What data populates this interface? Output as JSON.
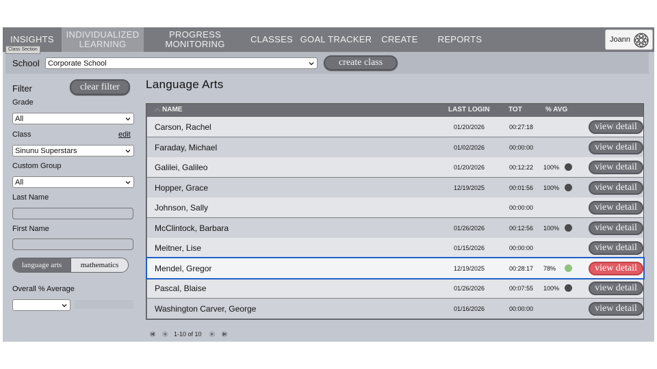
{
  "nav": {
    "items": [
      {
        "label": "INSIGHTS"
      },
      {
        "label": "INDIVIDUALIZED LEARNING"
      },
      {
        "label": "PROGRESS MONITORING"
      },
      {
        "label": "CLASSES"
      },
      {
        "label": "GOAL TRACKER"
      },
      {
        "label": "CREATE"
      },
      {
        "label": "REPORTS"
      }
    ],
    "tooltip": "Class Section",
    "user_name": "Joann"
  },
  "school": {
    "label": "School",
    "selected": "Corporate School",
    "create_class_label": "create class"
  },
  "filter": {
    "title": "Filter",
    "clear_label": "clear filter",
    "grade_label": "Grade",
    "grade_value": "All",
    "class_label": "Class",
    "edit_label": "edit",
    "class_value": "Sinunu Superstars",
    "custom_group_label": "Custom Group",
    "custom_group_value": "All",
    "last_name_label": "Last Name",
    "last_name_value": "",
    "first_name_label": "First Name",
    "first_name_value": "",
    "subjects": [
      "language arts",
      "mathematics"
    ],
    "overall_avg_label": "Overall % Average",
    "overall_avg_value": ""
  },
  "main": {
    "title": "Language Arts",
    "columns": {
      "name": "NAME",
      "last_login": "LAST LOGIN",
      "tot": "TOT",
      "avg": "% AVG"
    },
    "view_label": "view detail",
    "rows": [
      {
        "name": "Carson, Rachel",
        "last_login": "01/20/2026",
        "tot": "00:27:18",
        "avg": "",
        "dot": ""
      },
      {
        "name": "Faraday, Michael",
        "last_login": "01/02/2026",
        "tot": "00:00:00",
        "avg": "",
        "dot": ""
      },
      {
        "name": "Galilei, Galileo",
        "last_login": "01/20/2026",
        "tot": "00:12:22",
        "avg": "100%",
        "dot": "#4a4a4a"
      },
      {
        "name": "Hopper, Grace",
        "last_login": "12/19/2025",
        "tot": "00:01:56",
        "avg": "100%",
        "dot": "#4a4a4a"
      },
      {
        "name": "Johnson, Sally",
        "last_login": "",
        "tot": "00:00:00",
        "avg": "",
        "dot": ""
      },
      {
        "name": "McClintock, Barbara",
        "last_login": "01/26/2026",
        "tot": "00:12:56",
        "avg": "100%",
        "dot": "#4a4a4a"
      },
      {
        "name": "Meitner, Lise",
        "last_login": "01/15/2026",
        "tot": "00:00:00",
        "avg": "",
        "dot": ""
      },
      {
        "name": "Mendel, Gregor",
        "last_login": "12/19/2025",
        "tot": "00:28:17",
        "avg": "78%",
        "dot": "#8cc47e",
        "selected": true
      },
      {
        "name": "Pascal, Blaise",
        "last_login": "01/26/2026",
        "tot": "00:07:55",
        "avg": "100%",
        "dot": "#4a4a4a"
      },
      {
        "name": "Washington Carver, George",
        "last_login": "01/16/2026",
        "tot": "00:00:00",
        "avg": "",
        "dot": ""
      }
    ],
    "pager_text": "1-10 of 10"
  },
  "colors": {
    "selected_outline": "#1f5fc9",
    "view_detail_active": "#e15b63",
    "avg_dot_high": "#4a4a4a",
    "avg_dot_mid": "#8cc47e"
  }
}
